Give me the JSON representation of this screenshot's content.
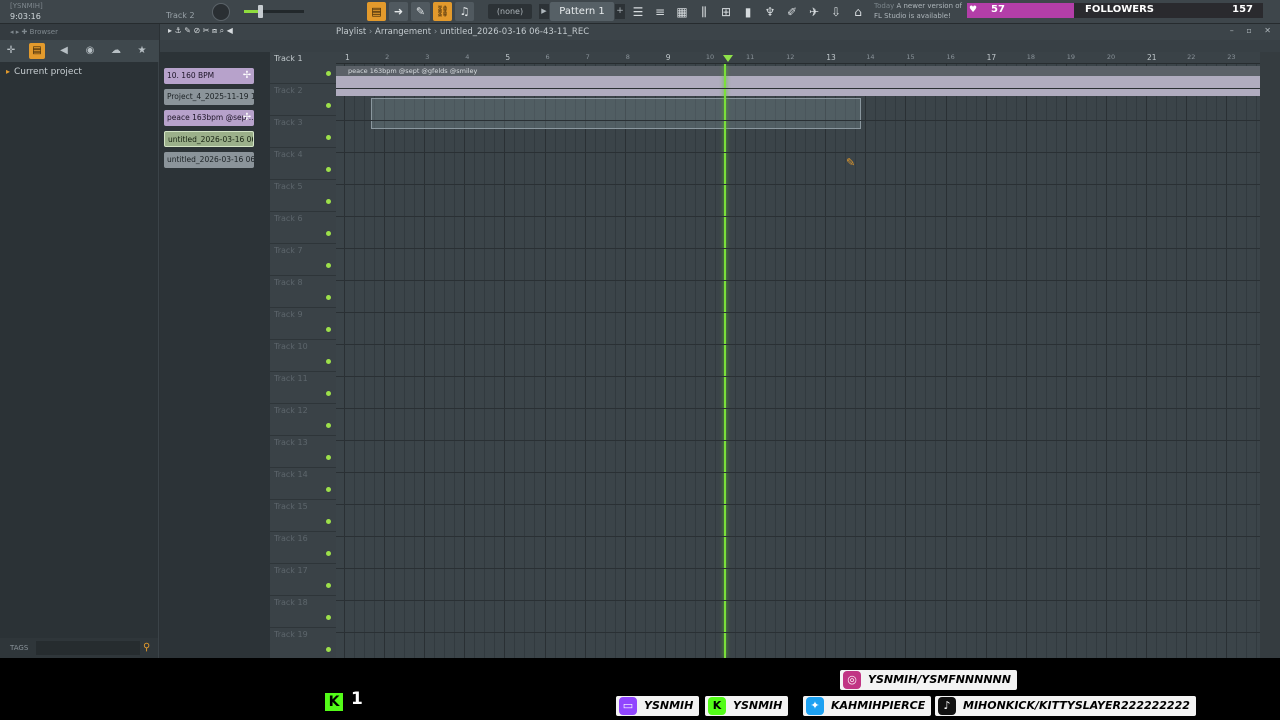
{
  "toolbar": {
    "title": "[YSNMIH]",
    "time": "9:03:16",
    "track_hint": "Track 2",
    "pattern_none": "(none)",
    "pattern_name": "Pattern 1",
    "news_today": "Today",
    "news_text": "A newer version of FL Studio is available!"
  },
  "followers": {
    "count": "57",
    "label": "FOLLOWERS",
    "goal": "157",
    "progress": 0.36,
    "color": "#b33ea8"
  },
  "browser": {
    "header": "Browser",
    "item": "Current project",
    "tags_label": "TAGS"
  },
  "playlist": {
    "title": "Playlist",
    "subtitle": "Arrangement",
    "project": "untitled_2026-03-16 06-43-11_REC",
    "clips": [
      {
        "label": "10. 160 BPM",
        "kind": "pattern"
      },
      {
        "label": "Project_4_2025-11-19 1...",
        "kind": "audio"
      },
      {
        "label": "peace 163bpm @sep...",
        "kind": "pattern"
      },
      {
        "label": "untitled_2026-03-16 06-...",
        "kind": "selected"
      },
      {
        "label": "untitled_2026-03-16 06-...",
        "kind": "audio"
      }
    ],
    "tracks": [
      "Track 1",
      "Track 2",
      "Track 3",
      "Track 4",
      "Track 5",
      "Track 6",
      "Track 7",
      "Track 8",
      "Track 9",
      "Track 10",
      "Track 11",
      "Track 12",
      "Track 13",
      "Track 14",
      "Track 15",
      "Track 16",
      "Track 17",
      "Track 18",
      "Track 19"
    ],
    "bars": [
      "1",
      "2",
      "3",
      "4",
      "5",
      "6",
      "7",
      "8",
      "9",
      "10",
      "11",
      "12",
      "13",
      "14",
      "15",
      "16",
      "17",
      "18",
      "19",
      "20",
      "21",
      "22",
      "23"
    ],
    "audio_clip_label": "peace 163bpm @sept @gfelds @smiley"
  },
  "overlay": {
    "kick_followers": "1",
    "instagram": "YSNMIH/YSMFNNNNNN",
    "twitch": "YSNMIH",
    "kick": "YSNMIH",
    "twitter": "KAHMIHPIERCE",
    "tiktok": "MIHONKICK/KITTYSLAYER222222222"
  }
}
